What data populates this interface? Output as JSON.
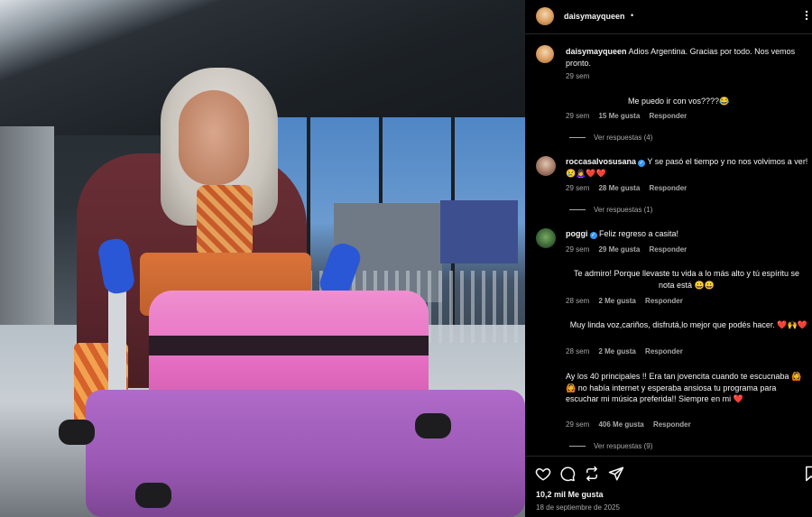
{
  "header": {
    "username": "daisymayqueen",
    "dot": "•"
  },
  "caption": {
    "username": "daisymayqueen",
    "text": "Adios Argentina. Gracias por todo. Nos vemos pronto.",
    "time": "29 sem"
  },
  "comments": [
    {
      "username": "",
      "text": "Me puedo ir con vos????😂",
      "time": "29 sem",
      "likes": "15 Me gusta",
      "reply": "Responder",
      "view_replies": "Ver respuestas (4)"
    },
    {
      "username": "roccasalvosusana",
      "text": "Y se pasó el tiempo y no nos volvimos a ver! 😢🙇‍♀️❤️❤️",
      "time": "29 sem",
      "likes": "28 Me gusta",
      "reply": "Responder",
      "view_replies": "Ver respuestas (1)"
    },
    {
      "username": "poggi",
      "text": "Feliz regreso a casita!",
      "time": "29 sem",
      "likes": "29 Me gusta",
      "reply": "Responder"
    },
    {
      "username": "",
      "text": "Te admiro! Porque llevaste tu vida a lo más alto y tú espíritu se nota está 😀😀",
      "time": "28 sem",
      "likes": "2 Me gusta",
      "reply": "Responder"
    },
    {
      "username": "",
      "text": "Muy linda voz,cariños, disfrutá,lo mejor que podés hacer. ❤️🙌❤️",
      "time": "28 sem",
      "likes": "2 Me gusta",
      "reply": "Responder"
    },
    {
      "username": "",
      "text": "Ay los 40 principales !! Era tan jovencita cuando te escucnaba 🙆🙆 no había internet y esperaba ansiosa tu programa para escuchar mi música preferida!! Siempre en mi ❤️",
      "time": "29 sem",
      "likes": "406 Me gusta",
      "reply": "Responder",
      "view_replies": "Ver respuestas (9)"
    }
  ],
  "footer": {
    "likes": "10,2 mil Me gusta",
    "date": "18 de septiembre de 2025"
  },
  "icons": [
    "heart-icon",
    "comment-icon",
    "repost-icon",
    "share-icon"
  ]
}
